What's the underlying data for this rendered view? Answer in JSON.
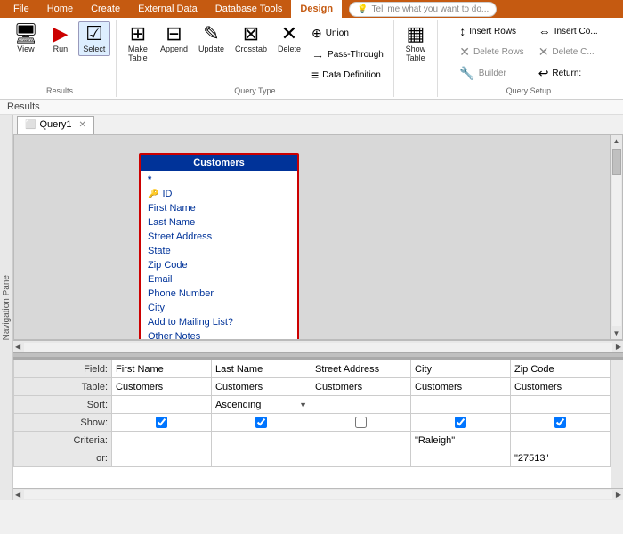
{
  "ribbon": {
    "tabs": [
      "File",
      "Home",
      "Create",
      "External Data",
      "Database Tools",
      "Design"
    ],
    "active_tab": "Design",
    "tell_me": "Tell me what you want to do...",
    "groups": {
      "results": {
        "label": "Results",
        "buttons": [
          {
            "id": "view",
            "icon": "🖥",
            "label": "View"
          },
          {
            "id": "run",
            "icon": "▶",
            "label": "Run"
          },
          {
            "id": "select",
            "icon": "☑",
            "label": "Select",
            "active": true
          }
        ]
      },
      "query_type": {
        "label": "Query Type",
        "buttons_large": [
          {
            "id": "make-table",
            "icon": "⊞",
            "label": "Make\nTable"
          },
          {
            "id": "append",
            "icon": "⊟",
            "label": "Append"
          },
          {
            "id": "update",
            "icon": "✎",
            "label": "Update"
          },
          {
            "id": "crosstab",
            "icon": "⊠",
            "label": "Crosstab"
          },
          {
            "id": "delete",
            "icon": "✕",
            "label": "Delete"
          }
        ],
        "buttons_small": [
          {
            "id": "union",
            "icon": "⊕",
            "label": "Union"
          },
          {
            "id": "pass-through",
            "icon": "→",
            "label": "Pass-Through"
          },
          {
            "id": "data-definition",
            "icon": "≡",
            "label": "Data Definition"
          }
        ]
      },
      "show_table": {
        "label": "",
        "buttons_large": [
          {
            "id": "show-table",
            "icon": "▦",
            "label": "Show\nTable"
          }
        ]
      },
      "query_setup": {
        "label": "Query Setup",
        "buttons_small": [
          {
            "id": "insert-rows",
            "icon": "↕",
            "label": "Insert Rows"
          },
          {
            "id": "delete-rows",
            "icon": "✕",
            "label": "Delete Rows"
          },
          {
            "id": "builder",
            "icon": "🔧",
            "label": "Builder"
          },
          {
            "id": "insert-columns",
            "icon": "⇔",
            "label": "Insert Co..."
          },
          {
            "id": "delete-columns",
            "icon": "✕",
            "label": "Delete C..."
          },
          {
            "id": "return",
            "icon": "↩",
            "label": "Return:"
          }
        ]
      }
    }
  },
  "results_bar": {
    "label": "Results"
  },
  "nav_pane": {
    "label": "Navigation Pane"
  },
  "query_tab": {
    "name": "Query1",
    "close_icon": "✕"
  },
  "customers_table": {
    "title": "Customers",
    "fields": [
      {
        "name": "*",
        "is_asterisk": true,
        "has_key": false
      },
      {
        "name": "ID",
        "is_asterisk": false,
        "has_key": true
      },
      {
        "name": "First Name",
        "is_asterisk": false,
        "has_key": false
      },
      {
        "name": "Last Name",
        "is_asterisk": false,
        "has_key": false
      },
      {
        "name": "Street Address",
        "is_asterisk": false,
        "has_key": false
      },
      {
        "name": "State",
        "is_asterisk": false,
        "has_key": false
      },
      {
        "name": "Zip Code",
        "is_asterisk": false,
        "has_key": false
      },
      {
        "name": "Email",
        "is_asterisk": false,
        "has_key": false
      },
      {
        "name": "Phone Number",
        "is_asterisk": false,
        "has_key": false
      },
      {
        "name": "City",
        "is_asterisk": false,
        "has_key": false
      },
      {
        "name": "Add to Mailing List?",
        "is_asterisk": false,
        "has_key": false
      },
      {
        "name": "Other Notes",
        "is_asterisk": false,
        "has_key": false
      }
    ]
  },
  "qbe": {
    "rows": [
      "Field:",
      "Table:",
      "Sort:",
      "Show:",
      "Criteria:",
      "or:"
    ],
    "columns": [
      {
        "field": "First Name",
        "table": "Customers",
        "sort": "",
        "show": true,
        "criteria": "",
        "or": ""
      },
      {
        "field": "Last Name",
        "table": "Customers",
        "sort": "Ascending",
        "show": true,
        "criteria": "",
        "or": ""
      },
      {
        "field": "Street Address",
        "table": "Customers",
        "sort": "",
        "show": false,
        "criteria": "",
        "or": ""
      },
      {
        "field": "City",
        "table": "Customers",
        "sort": "",
        "show": true,
        "criteria": "\"Raleigh\"",
        "or": ""
      },
      {
        "field": "Zip Code",
        "table": "Customers",
        "sort": "",
        "show": true,
        "criteria": "",
        "or": "\"27513\""
      }
    ]
  }
}
